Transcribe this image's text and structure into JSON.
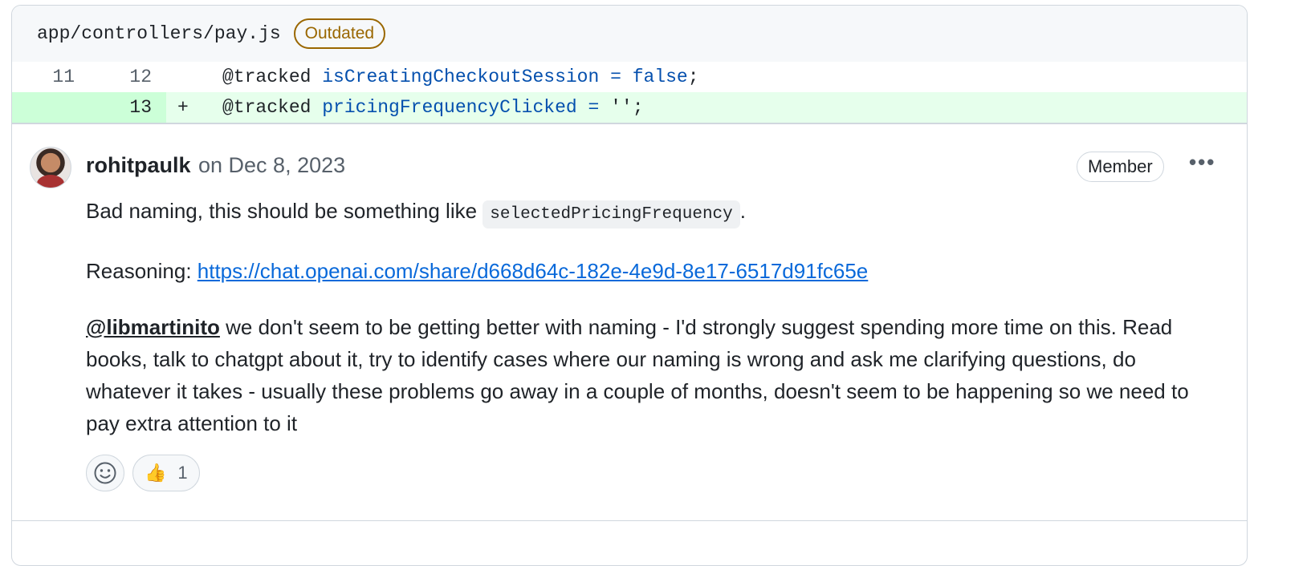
{
  "file": {
    "path": "app/controllers/pay.js",
    "badge": "Outdated"
  },
  "diff": {
    "rows": [
      {
        "old_line": "11",
        "new_line": "12",
        "marker": "",
        "code_prefix": "@tracked ",
        "code_ident": "isCreatingCheckoutSession = false",
        "code_suffix": ";"
      },
      {
        "old_line": "",
        "new_line": "13",
        "marker": "+",
        "code_prefix": "@tracked ",
        "code_ident": "pricingFrequencyClicked = ",
        "code_suffix": "'';"
      }
    ]
  },
  "comment": {
    "author": "rohitpaulk",
    "date": "on Dec 8, 2023",
    "role_badge": "Member",
    "menu_icon": "kebab-horizontal-icon",
    "para1_text": "Bad naming, this should be something like ",
    "para1_code": "selectedPricingFrequency",
    "para1_end": ".",
    "para2_label": "Reasoning: ",
    "para2_link": "https://chat.openai.com/share/d668d64c-182e-4e9d-8e17-6517d91fc65e",
    "para3_mention": "@libmartinito",
    "para3_text": " we don't seem to be getting better with naming - I'd strongly suggest spending more time on this. Read books, talk to chatgpt about it, try to identify cases where our naming is wrong and ask me clarifying questions, do whatever it takes - usually these problems go away in a couple of months, doesn't seem to be happening so we need to pay extra attention to it",
    "reactions": {
      "add_icon": "smiley-icon",
      "thumbs_up_emoji": "👍",
      "thumbs_up_count": "1"
    }
  },
  "colors": {
    "added_bg": "#e6ffec",
    "link": "#0969da",
    "outdated": "#9a6700"
  }
}
